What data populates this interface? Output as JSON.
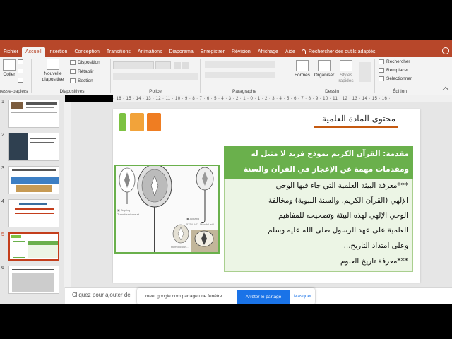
{
  "ribbon_tabs": [
    "Fichier",
    "Accueil",
    "Insertion",
    "Conception",
    "Transitions",
    "Animations",
    "Diaporama",
    "Enregistrer",
    "Révision",
    "Affichage",
    "Aide"
  ],
  "search_tab": "Rechercher des outils adaptés",
  "ribbon": {
    "paste": "Coller",
    "clipboard_group": "resse-papiers",
    "new_slide_1": "Nouvelle",
    "new_slide_2": "diapositive",
    "layout": "Disposition",
    "reset": "Rétablir",
    "section": "Section",
    "slides_group": "Diapositives",
    "font_group": "Police",
    "paragraph_group": "Paragraphe",
    "shapes": "Formes",
    "arrange": "Organiser",
    "quick_styles_1": "Styles",
    "quick_styles_2": "rapides",
    "drawing_group": "Dessin",
    "find": "Rechercher",
    "replace": "Remplacer",
    "select": "Sélectionner",
    "editing_group": "Édition"
  },
  "ruler_text": "· 16 · 15 · 14 · 13 · 12 · 11 · 10 · 9 · 8 · 7 · 6 · 5 · 4 · 3 · 2 · 1 · 0 · 1 · 2 · 3 · 4 · 5 · 6 · 7 · 8 · 9 · 10 · 11 · 12 · 13 · 14 · 15 · 16 ·",
  "slide_numbers": [
    "1",
    "2",
    "3",
    "4",
    "5",
    "6"
  ],
  "slide": {
    "title": "محتوى المادة العلمية",
    "line1": "مقدمة: القرآن الكريم نموذج فريد لا مثيل له",
    "line2": "ومقدمات مهمة عن الإعجاز في القرآن والسنة",
    "line3": "***معرفة البيئة العلمية التي جاء فيها الوحي",
    "line4": "الإلهي (القرآن الكريم، والسنة النبوية) ومخالفة",
    "line5": "الوحي الإلهي لهذه البيئة وتصحيحه للمفاهيم",
    "line6": "العلمية على عهد الرسول صلى الله عليه وسلم",
    "line7": "وعلى امتداد التاريخ...",
    "line8": "***معرفة تاريخ العلوم",
    "img_caption_1": "Transformisme et...",
    "img_caption_2": "5754 1/7 - Mendel et l...",
    "img_caption_3": "Homonculus..."
  },
  "notes_placeholder": "Cliquez pour ajouter de",
  "share": {
    "text": "meet.google.com partage une fenêtre.",
    "stop_button": "Arrêter le partage",
    "hide_link": "Masquer"
  },
  "colors": {
    "accent": "#b7472a",
    "slide_green": "#6ab04c",
    "sq_green": "#7dc242",
    "sq_orange1": "#f2a33a",
    "sq_orange2": "#ef7d22",
    "share_blue": "#1a73e8"
  }
}
